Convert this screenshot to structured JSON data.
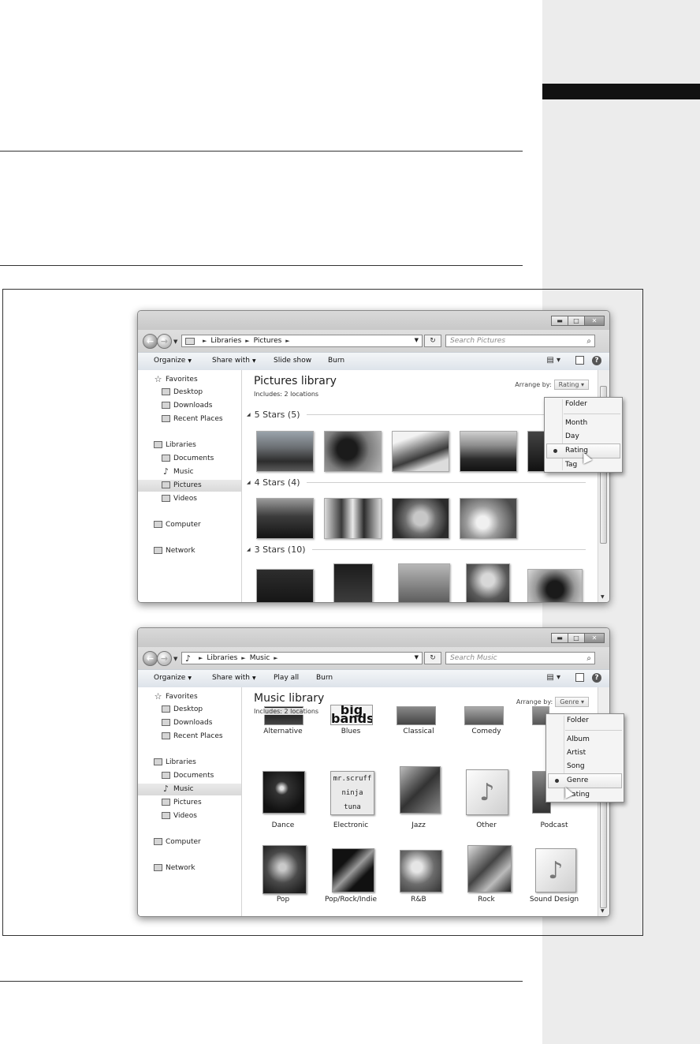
{
  "windows": [
    {
      "id": "pictures",
      "breadcrumb": [
        "Libraries",
        "Pictures"
      ],
      "search_placeholder": "Search Pictures",
      "toolbar": [
        "Organize",
        "Share with",
        "Slide show",
        "Burn"
      ],
      "library_title": "Pictures library",
      "library_subtitle": "Includes: 2 locations",
      "arrange_label": "Arrange by:",
      "arrange_value": "Rating",
      "groups": [
        "5 Stars (5)",
        "4 Stars (4)",
        "3 Stars (10)"
      ],
      "menu": {
        "group1": [
          "Folder"
        ],
        "group2": [
          "Month",
          "Day",
          "Rating",
          "Tag"
        ],
        "selected": "Rating"
      }
    },
    {
      "id": "music",
      "breadcrumb": [
        "Libraries",
        "Music"
      ],
      "search_placeholder": "Search Music",
      "toolbar": [
        "Organize",
        "Share with",
        "Play all",
        "Burn"
      ],
      "library_title": "Music library",
      "library_subtitle": "Includes: 2 locations",
      "arrange_label": "Arrange by:",
      "arrange_value": "Genre",
      "genres_row1": [
        "Alternative",
        "Blues",
        "Classical",
        "Comedy"
      ],
      "genres_row2": [
        "Dance",
        "Electronic",
        "Jazz",
        "Other",
        "Podcast"
      ],
      "genres_row3": [
        "Pop",
        "Pop/Rock/Indie",
        "R&B",
        "Rock",
        "Sound Design"
      ],
      "album_text": {
        "blues": "big bands",
        "electronic": "mr.scruff ninja tuna"
      },
      "menu": {
        "group1": [
          "Folder"
        ],
        "group2": [
          "Album",
          "Artist",
          "Song",
          "Genre",
          "Rating"
        ],
        "selected": "Genre"
      }
    }
  ],
  "navigation": {
    "favorites": "Favorites",
    "favorites_items": [
      "Desktop",
      "Downloads",
      "Recent Places"
    ],
    "libraries": "Libraries",
    "libraries_items": [
      "Documents",
      "Music",
      "Pictures",
      "Videos"
    ],
    "computer": "Computer",
    "network": "Network"
  },
  "caption_buttons": [
    "minimize",
    "maximize",
    "close"
  ],
  "icons": [
    "back-arrow-icon",
    "forward-arrow-icon",
    "refresh-icon",
    "search-icon",
    "help-icon",
    "star-icon",
    "music-note-icon",
    "folder-icon",
    "computer-icon",
    "network-icon",
    "mouse-cursor-icon"
  ]
}
